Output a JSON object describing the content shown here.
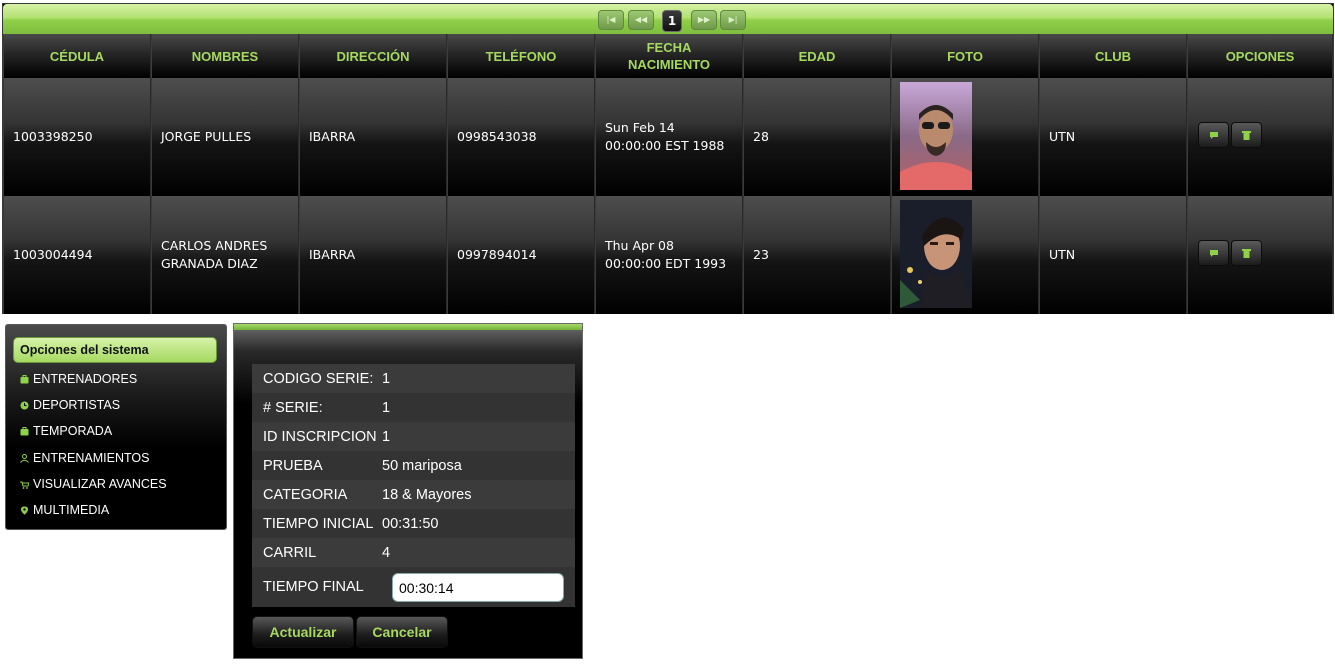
{
  "pager": {
    "first": "|◀",
    "prev": "◀◀",
    "current": "1",
    "next": "▶▶",
    "last": "▶|"
  },
  "table": {
    "headers": [
      "CÉDULA",
      "NOMBRES",
      "DIRECCIÓN",
      "TELÉFONO",
      "FECHA NACIMIENTO",
      "EDAD",
      "FOTO",
      "CLUB",
      "OPCIONES"
    ],
    "rows": [
      {
        "cedula": "1003398250",
        "nombres": "JORGE PULLES",
        "direccion": "IBARRA",
        "telefono": "0998543038",
        "fecha": "Sun Feb 14 00:00:00 EST 1988",
        "edad": "28",
        "club": "UTN"
      },
      {
        "cedula": "1003004494",
        "nombres": "CARLOS ANDRES GRANADA DIAZ",
        "direccion": "IBARRA",
        "telefono": "0997894014",
        "fecha": "Thu Apr 08 00:00:00 EDT 1993",
        "edad": "23",
        "club": "UTN"
      }
    ],
    "option_icons": [
      "edit-icon",
      "trash-icon"
    ]
  },
  "menu": {
    "title": "Opciones del sistema",
    "items": [
      {
        "label": "ENTRENADORES",
        "icon": "suitcase-icon"
      },
      {
        "label": "DEPORTISTAS",
        "icon": "clock-icon"
      },
      {
        "label": "TEMPORADA",
        "icon": "suitcase-icon"
      },
      {
        "label": "ENTRENAMIENTOS",
        "icon": "person-icon"
      },
      {
        "label": "VISUALIZAR AVANCES",
        "icon": "cart-icon"
      },
      {
        "label": "MULTIMEDIA",
        "icon": "pin-icon"
      }
    ]
  },
  "dialog": {
    "fields": [
      {
        "label": "CODIGO SERIE:",
        "value": "1"
      },
      {
        "label": "# SERIE:",
        "value": "1"
      },
      {
        "label": "ID INSCRIPCION",
        "value": "1"
      },
      {
        "label": "PRUEBA",
        "value": "50 mariposa"
      },
      {
        "label": "CATEGORIA",
        "value": "18 & Mayores"
      },
      {
        "label": "TIEMPO INICIAL",
        "value": "00:31:50"
      },
      {
        "label": "CARRIL",
        "value": "4"
      }
    ],
    "final_label": "TIEMPO FINAL",
    "final_value": "00:30:14",
    "update_label": "Actualizar",
    "cancel_label": "Cancelar"
  },
  "colors": {
    "accent_green": "#a6d95f",
    "header_bar": "#8fcf47"
  }
}
